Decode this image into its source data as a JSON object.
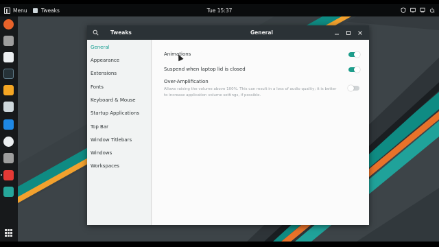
{
  "topbar": {
    "activities_label": "Menu",
    "app_name": "Tweaks",
    "clock": "Tue 15:37",
    "tray_icons": [
      "shield-icon",
      "screen-icon",
      "network-icon",
      "power-icon"
    ]
  },
  "dock": {
    "items": [
      "firefox-icon",
      "files-icon",
      "text-editor-icon",
      "terminal-icon",
      "download-icon",
      "image-viewer-icon",
      "monitor-icon",
      "disc-icon",
      "tweaks-icon",
      "hotspot-icon"
    ],
    "show_apps_icon": "grid-icon"
  },
  "window": {
    "title": "Tweaks",
    "section_title": "General",
    "controls": [
      "minimize-icon",
      "maximize-icon",
      "close-icon"
    ],
    "accent_color": "#0f9b8e",
    "sidebar": {
      "items": [
        {
          "label": "General",
          "active": true
        },
        {
          "label": "Appearance",
          "active": false
        },
        {
          "label": "Extensions",
          "active": false
        },
        {
          "label": "Fonts",
          "active": false
        },
        {
          "label": "Keyboard & Mouse",
          "active": false
        },
        {
          "label": "Startup Applications",
          "active": false
        },
        {
          "label": "Top Bar",
          "active": false
        },
        {
          "label": "Window Titlebars",
          "active": false
        },
        {
          "label": "Windows",
          "active": false
        },
        {
          "label": "Workspaces",
          "active": false
        }
      ]
    },
    "settings": {
      "animations": {
        "label": "Animations",
        "enabled": true
      },
      "suspend": {
        "label": "Suspend when laptop lid is closed",
        "enabled": true
      },
      "over_amplification": {
        "label": "Over-Amplification",
        "description": "Allows raising the volume above 100%. This can result in a loss of audio quality; it is better to increase application volume settings, if possible.",
        "enabled": false
      }
    }
  }
}
